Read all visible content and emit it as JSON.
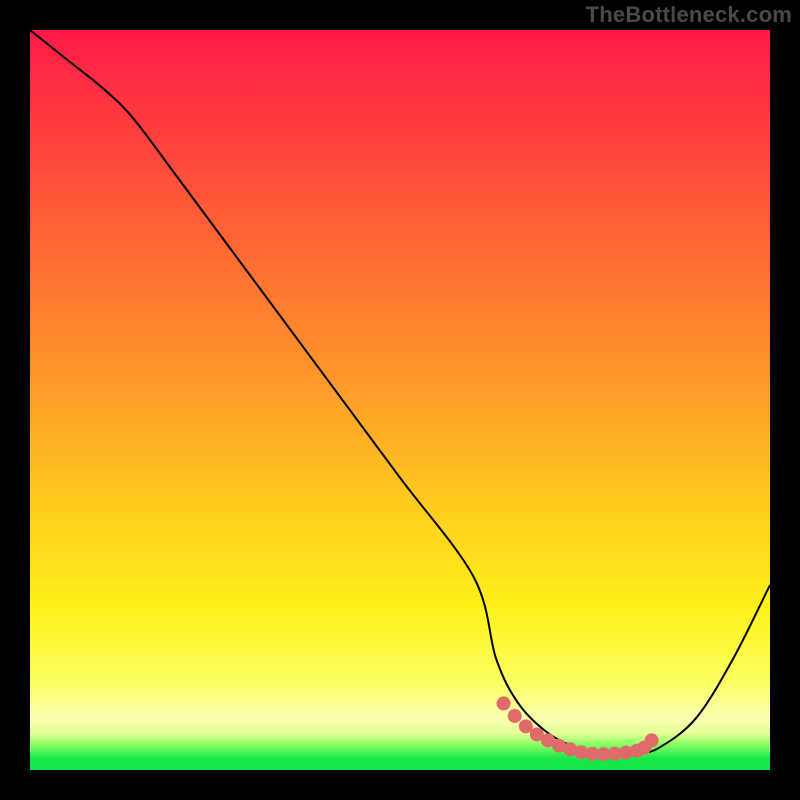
{
  "watermark": "TheBottleneck.com",
  "chart_data": {
    "type": "line",
    "title": "",
    "xlabel": "",
    "ylabel": "",
    "xlim": [
      0,
      100
    ],
    "ylim": [
      0,
      100
    ],
    "grid": false,
    "legend": false,
    "gradient_stops": [
      {
        "offset": 0.0,
        "color": "#ff1a47"
      },
      {
        "offset": 0.12,
        "color": "#ff3a3f"
      },
      {
        "offset": 0.3,
        "color": "#ff6a33"
      },
      {
        "offset": 0.48,
        "color": "#ff9a2a"
      },
      {
        "offset": 0.62,
        "color": "#ffc51f"
      },
      {
        "offset": 0.78,
        "color": "#fff11a"
      },
      {
        "offset": 0.88,
        "color": "#fcff60"
      },
      {
        "offset": 0.93,
        "color": "#faffb0"
      },
      {
        "offset": 0.95,
        "color": "#e6ff99"
      },
      {
        "offset": 0.965,
        "color": "#8dff66"
      },
      {
        "offset": 0.985,
        "color": "#17e84a"
      },
      {
        "offset": 1.0,
        "color": "#15e848"
      }
    ],
    "series": [
      {
        "name": "bottleneck-curve",
        "color": "#000000",
        "stroke_width": 2,
        "x": [
          0,
          5,
          10,
          14,
          20,
          30,
          40,
          50,
          60,
          63,
          66,
          70,
          74,
          78,
          82,
          85,
          90,
          95,
          100
        ],
        "y": [
          100,
          96,
          92,
          88,
          80,
          66.5,
          53,
          39.5,
          26,
          15,
          9,
          5,
          3,
          2.2,
          2.3,
          3,
          7,
          15,
          25
        ]
      }
    ],
    "marker": {
      "name": "optimal-range-marker",
      "color": "#e06a6a",
      "points": [
        {
          "x": 64,
          "y": 9
        },
        {
          "x": 65.5,
          "y": 7.3
        },
        {
          "x": 67,
          "y": 5.9
        },
        {
          "x": 68.5,
          "y": 4.8
        },
        {
          "x": 70,
          "y": 4
        },
        {
          "x": 71.5,
          "y": 3.3
        },
        {
          "x": 73,
          "y": 2.8
        },
        {
          "x": 74.5,
          "y": 2.4
        },
        {
          "x": 76,
          "y": 2.2
        },
        {
          "x": 77.5,
          "y": 2.15
        },
        {
          "x": 79,
          "y": 2.2
        },
        {
          "x": 80.5,
          "y": 2.35
        },
        {
          "x": 82,
          "y": 2.6
        },
        {
          "x": 83,
          "y": 3
        },
        {
          "x": 84,
          "y": 4
        }
      ],
      "radius": 7
    }
  }
}
